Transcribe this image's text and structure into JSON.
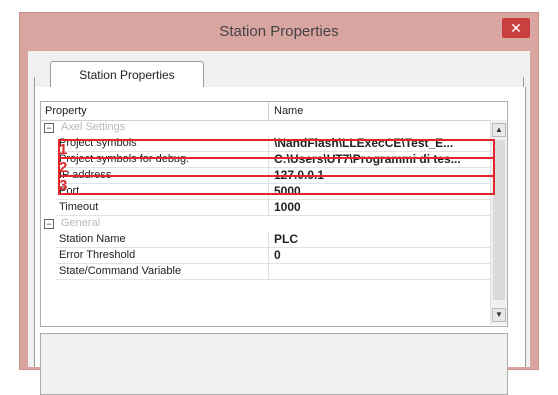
{
  "window": {
    "title": "Station Properties",
    "close": "✕"
  },
  "tab": {
    "label": "Station Properties"
  },
  "grid": {
    "columns": {
      "property": "Property",
      "name": "Name"
    },
    "rows": [
      {
        "type": "category",
        "label": "Axel Settings",
        "expander": "⊟"
      },
      {
        "type": "item",
        "label": "Project symbols",
        "value": "\\NandFlash\\LLExecCE\\Test_E..."
      },
      {
        "type": "item",
        "label": "Project symbols for debug.",
        "value": "C:\\Users\\UT7\\Programmi di tes..."
      },
      {
        "type": "item",
        "label": "IP address",
        "value": "127.0.0.1"
      },
      {
        "type": "item",
        "label": "Port",
        "value": "5000"
      },
      {
        "type": "item",
        "label": "Timeout",
        "value": "1000"
      },
      {
        "type": "category",
        "label": "General",
        "expander": "⊟"
      },
      {
        "type": "item",
        "label": "Station Name",
        "value": "PLC"
      },
      {
        "type": "item",
        "label": "Error Threshold",
        "value": "0"
      },
      {
        "type": "item",
        "label": "State/Command Variable",
        "value": ""
      }
    ]
  },
  "annotations": {
    "one": "1",
    "two": "2",
    "three": "3"
  },
  "colors": {
    "titlebar": "#d9a5a0",
    "close": "#c9403f",
    "highlight": "#e3262b"
  },
  "icons": {
    "scroll_up": "▲",
    "scroll_down": "▼"
  }
}
